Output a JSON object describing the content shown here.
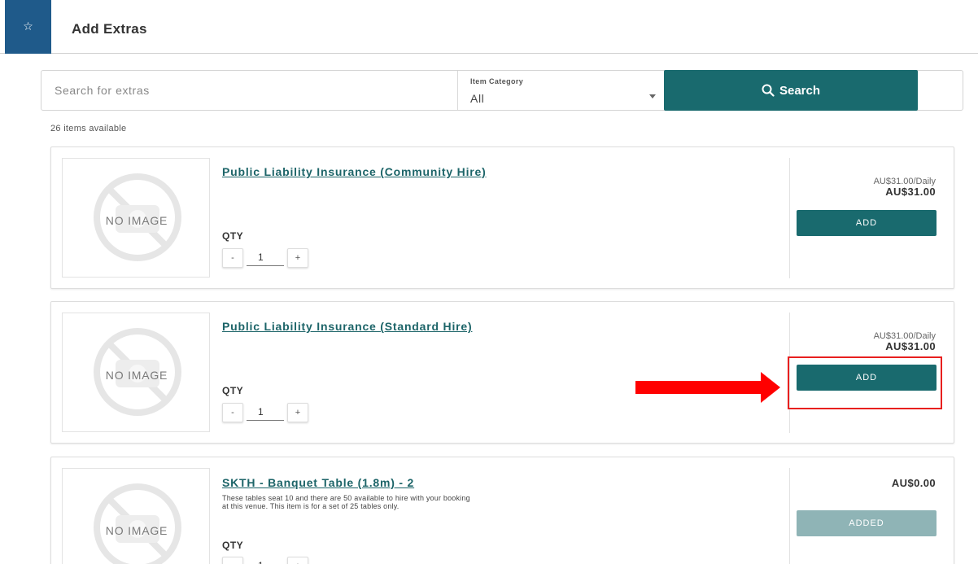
{
  "header": {
    "title": "Add Extras",
    "star_glyph": "☆"
  },
  "search": {
    "placeholder": "Search for extras",
    "category_label": "Item Category",
    "category_value": "All",
    "button_label": "Search"
  },
  "items_count_text": "26 items available",
  "no_image_text": "NO IMAGE",
  "qty_label": "QTY",
  "minus": "-",
  "plus": "+",
  "items": [
    {
      "name": "Public Liability Insurance (Community Hire)",
      "description": "",
      "qty": "1",
      "price_per": "AU$31.00/Daily",
      "price_total": "AU$31.00",
      "button_label": "ADD",
      "added": false
    },
    {
      "name": "Public Liability Insurance (Standard Hire)",
      "description": "",
      "qty": "1",
      "price_per": "AU$31.00/Daily",
      "price_total": "AU$31.00",
      "button_label": "ADD",
      "added": false
    },
    {
      "name": "SKTH - Banquet Table (1.8m) - 2",
      "description": "These tables seat 10 and there are 50 available to hire with your booking at this venue. This item is for a set of 25 tables only.",
      "qty": "1",
      "price_per": "",
      "price_total": "AU$0.00",
      "button_label": "ADDED",
      "added": true
    }
  ],
  "colors": {
    "accent": "#196a6e",
    "header_tab": "#1f5a8a",
    "added_button": "#8fb4b6",
    "annotation": "#ff0000"
  }
}
